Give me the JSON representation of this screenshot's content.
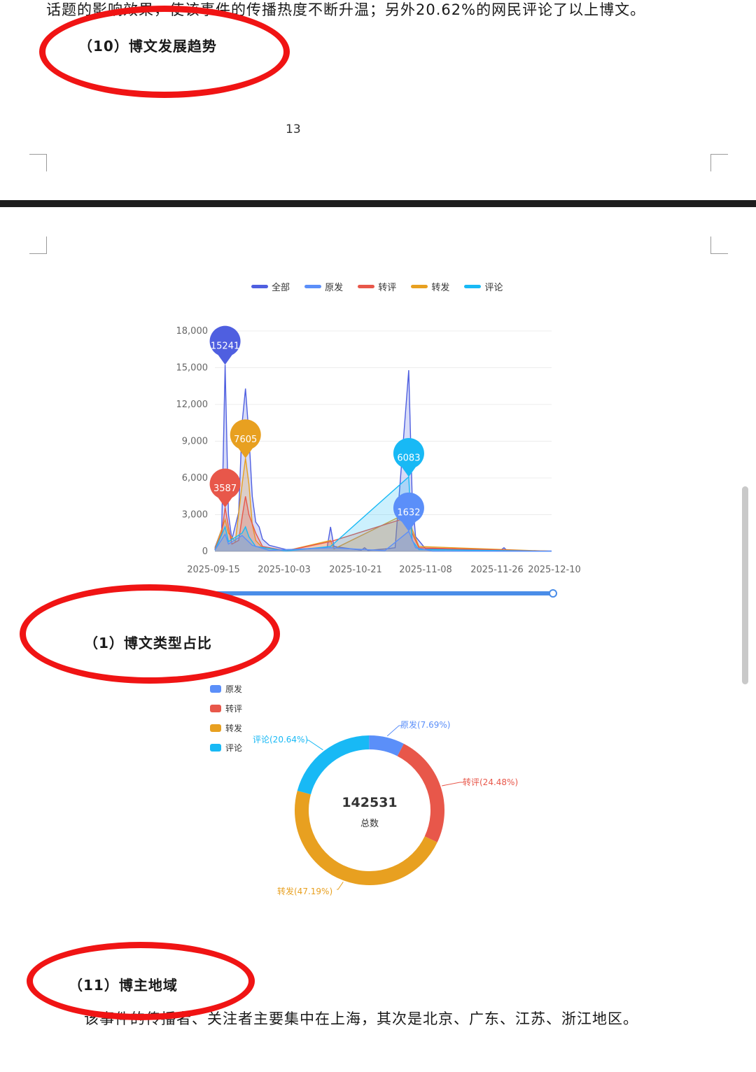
{
  "page_top": {
    "text_line": "话题的影响效果，使该事件的传播热度不断升温；另外20.62%的网民评论了以上博文。",
    "heading": "（10）博文发展趋势",
    "page_number": "13"
  },
  "colors": {
    "all": "#4f5fe0",
    "original": "#5b8ff9",
    "comment_repost": "#e8574a",
    "repost": "#e8a020",
    "comment": "#18b9f5",
    "annotation": "#f01414"
  },
  "trend_chart": {
    "legend": [
      "全部",
      "原发",
      "转评",
      "转发",
      "评论"
    ],
    "y_ticks": [
      "18,000",
      "15,000",
      "12,000",
      "9,000",
      "6,000",
      "3,000",
      "0"
    ],
    "x_ticks": [
      "2025-09-15",
      "2025-10-03",
      "2025-10-21",
      "2025-11-08",
      "2025-11-26",
      "2025-12-10"
    ],
    "bubbles": [
      "15241",
      "7605",
      "3587",
      "6083",
      "1632"
    ]
  },
  "chart_data": [
    {
      "type": "area",
      "x_ticks": [
        "2025-09-15",
        "2025-10-03",
        "2025-10-21",
        "2025-11-08",
        "2025-11-26",
        "2025-12-10"
      ],
      "ylim": [
        0,
        18000
      ],
      "x_range": [
        "2025-09-12",
        "2025-12-20"
      ],
      "series": [
        {
          "name": "全部",
          "color": "#4f5fe0",
          "points": [
            [
              "2025-09-12",
              300
            ],
            [
              "2025-09-14",
              1800
            ],
            [
              "2025-09-15",
              15241
            ],
            [
              "2025-09-16",
              3000
            ],
            [
              "2025-09-17",
              1000
            ],
            [
              "2025-09-19",
              3200
            ],
            [
              "2025-09-20",
              10500
            ],
            [
              "2025-09-21",
              13300
            ],
            [
              "2025-09-22",
              9500
            ],
            [
              "2025-09-23",
              4500
            ],
            [
              "2025-09-24",
              2400
            ],
            [
              "2025-09-25",
              2000
            ],
            [
              "2025-09-26",
              1000
            ],
            [
              "2025-09-28",
              500
            ],
            [
              "2025-10-03",
              150
            ],
            [
              "2025-10-15",
              300
            ],
            [
              "2025-10-16",
              2000
            ],
            [
              "2025-10-17",
              400
            ],
            [
              "2025-10-25",
              100
            ],
            [
              "2025-10-26",
              300
            ],
            [
              "2025-10-27",
              80
            ],
            [
              "2025-11-01",
              200
            ],
            [
              "2025-11-04",
              300
            ],
            [
              "2025-11-08",
              14800
            ],
            [
              "2025-11-09",
              4500
            ],
            [
              "2025-11-10",
              1200
            ],
            [
              "2025-11-13",
              200
            ],
            [
              "2025-12-05",
              100
            ],
            [
              "2025-12-06",
              300
            ],
            [
              "2025-12-07",
              50
            ],
            [
              "2025-12-20",
              30
            ]
          ]
        },
        {
          "name": "原发",
          "color": "#5b8ff9",
          "points": [
            [
              "2025-09-12",
              100
            ],
            [
              "2025-09-15",
              1400
            ],
            [
              "2025-09-16",
              600
            ],
            [
              "2025-09-20",
              1300
            ],
            [
              "2025-09-23",
              500
            ],
            [
              "2025-09-28",
              80
            ],
            [
              "2025-10-16",
              300
            ],
            [
              "2025-11-01",
              60
            ],
            [
              "2025-11-08",
              1632
            ],
            [
              "2025-11-10",
              300
            ],
            [
              "2025-11-15",
              30
            ],
            [
              "2025-12-20",
              10
            ]
          ]
        },
        {
          "name": "转评",
          "color": "#e8574a",
          "points": [
            [
              "2025-09-12",
              150
            ],
            [
              "2025-09-14",
              1500
            ],
            [
              "2025-09-15",
              3587
            ],
            [
              "2025-09-16",
              2000
            ],
            [
              "2025-09-17",
              600
            ],
            [
              "2025-09-19",
              900
            ],
            [
              "2025-09-20",
              2800
            ],
            [
              "2025-09-21",
              4500
            ],
            [
              "2025-09-22",
              3000
            ],
            [
              "2025-09-24",
              1500
            ],
            [
              "2025-09-26",
              400
            ],
            [
              "2025-10-03",
              50
            ],
            [
              "2025-10-16",
              800
            ],
            [
              "2025-11-08",
              2800
            ],
            [
              "2025-11-09",
              1500
            ],
            [
              "2025-11-11",
              300
            ],
            [
              "2025-12-20",
              10
            ]
          ]
        },
        {
          "name": "转发",
          "color": "#e8a020",
          "points": [
            [
              "2025-09-12",
              200
            ],
            [
              "2025-09-15",
              2600
            ],
            [
              "2025-09-16",
              1500
            ],
            [
              "2025-09-18",
              800
            ],
            [
              "2025-09-20",
              5500
            ],
            [
              "2025-09-21",
              7605
            ],
            [
              "2025-09-22",
              5500
            ],
            [
              "2025-09-23",
              2200
            ],
            [
              "2025-09-24",
              900
            ],
            [
              "2025-09-26",
              300
            ],
            [
              "2025-10-03",
              50
            ],
            [
              "2025-10-16",
              900
            ],
            [
              "2025-10-17",
              200
            ],
            [
              "2025-11-08",
              3200
            ],
            [
              "2025-11-09",
              1800
            ],
            [
              "2025-11-11",
              400
            ],
            [
              "2025-12-20",
              10
            ]
          ]
        },
        {
          "name": "评论",
          "color": "#18b9f5",
          "points": [
            [
              "2025-09-12",
              100
            ],
            [
              "2025-09-15",
              2000
            ],
            [
              "2025-09-16",
              800
            ],
            [
              "2025-09-20",
              1500
            ],
            [
              "2025-09-21",
              2000
            ],
            [
              "2025-09-22",
              1200
            ],
            [
              "2025-09-24",
              400
            ],
            [
              "2025-10-03",
              40
            ],
            [
              "2025-10-16",
              400
            ],
            [
              "2025-11-08",
              6083
            ],
            [
              "2025-11-09",
              900
            ],
            [
              "2025-11-11",
              150
            ],
            [
              "2025-12-20",
              10
            ]
          ]
        }
      ],
      "markers": [
        {
          "series": "全部",
          "x": "2025-09-15",
          "value": 15241
        },
        {
          "series": "转发",
          "x": "2025-09-21",
          "value": 7605
        },
        {
          "series": "转评",
          "x": "2025-09-15",
          "value": 3587
        },
        {
          "series": "评论",
          "x": "2025-11-08",
          "value": 6083
        },
        {
          "series": "原发",
          "x": "2025-11-08",
          "value": 1632
        }
      ],
      "legend": "top"
    },
    {
      "type": "pie",
      "donut": true,
      "total": 142531,
      "slices": [
        {
          "name": "原发",
          "percent": 7.69,
          "color": "#5b8ff9"
        },
        {
          "name": "转评",
          "percent": 24.48,
          "color": "#e8574a"
        },
        {
          "name": "转发",
          "percent": 47.19,
          "color": "#e8a020"
        },
        {
          "name": "评论",
          "percent": 20.64,
          "color": "#18b9f5"
        }
      ],
      "legend": "top-left"
    }
  ],
  "section_type": {
    "heading": "（1）博文类型占比",
    "legend": [
      "原发",
      "转评",
      "转发",
      "评论"
    ],
    "total_value": "142531",
    "total_label": "总数",
    "slice_labels": [
      "原发(7.69%)",
      "转评(24.48%)",
      "转发(47.19%)",
      "评论(20.64%)"
    ]
  },
  "section_region": {
    "heading": "（11）博主地域",
    "text_line": "该事件的传播者、关注者主要集中在上海，其次是北京、广东、江苏、浙江地区。"
  }
}
